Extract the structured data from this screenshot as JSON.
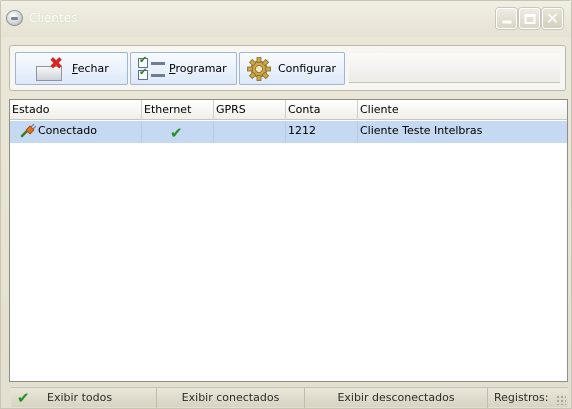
{
  "window": {
    "title": "Clientes",
    "title_color": "#ffffff",
    "controls": [
      "minimize-icon",
      "maximize-icon",
      "close-icon"
    ]
  },
  "toolbar": {
    "buttons": [
      {
        "label_prefix": "",
        "label_underlined": "F",
        "label_rest": "echar",
        "icon": "close-box-icon"
      },
      {
        "label_prefix": "",
        "label_underlined": "P",
        "label_rest": "rogramar",
        "icon": "checklist-icon"
      },
      {
        "label_prefix": "",
        "label_underlined": "",
        "label_rest": "Configurar",
        "icon": "gear-icon"
      }
    ]
  },
  "table": {
    "columns": [
      "Estado",
      "Ethernet",
      "GPRS",
      "Conta",
      "Cliente"
    ],
    "rows": [
      {
        "estado": "Conectado",
        "estado_icon": "connected-plug-icon",
        "ethernet": "checkmark-icon",
        "gprs": "",
        "conta": "1212",
        "cliente": "Cliente Teste Intelbras"
      }
    ],
    "selected_row_color": "#c6d9f3"
  },
  "statusbar": {
    "exibir_todos": "Exibir todos",
    "exibir_conectados": "Exibir conectados",
    "exibir_desconectados": "Exibir desconectados",
    "registros": "Registros:"
  },
  "colors": {
    "check_green": "#22931f",
    "close_red": "#d8261d",
    "toolbar_button_border": "#9fb6d9"
  }
}
